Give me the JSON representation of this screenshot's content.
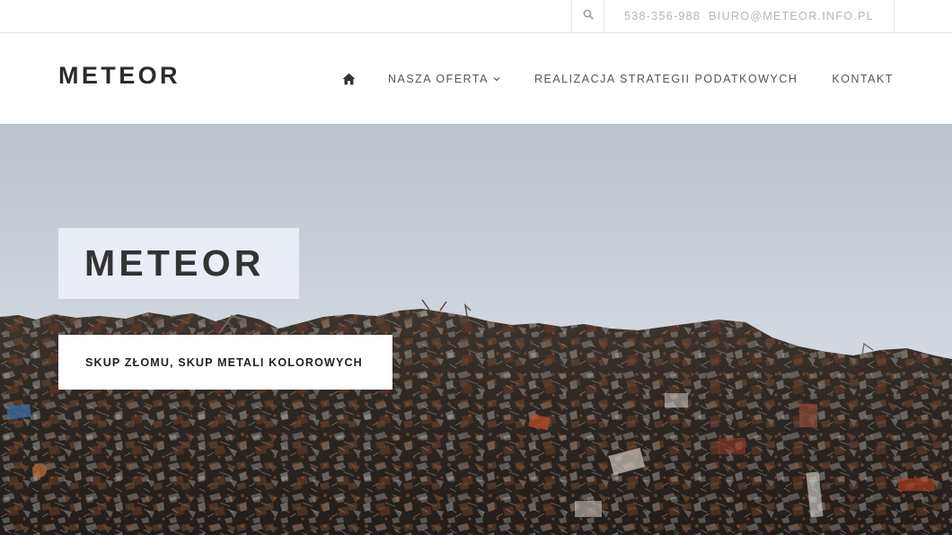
{
  "topbar": {
    "search_icon": "search-icon",
    "phone": "538-356-988",
    "email": "BIURO@METEOR.INFO.PL"
  },
  "header": {
    "logo": "METEOR",
    "nav": {
      "home_icon": "home-icon",
      "items": [
        {
          "label": "NASZA OFERTA",
          "has_dropdown": true
        },
        {
          "label": "REALIZACJA STRATEGII PODATKOWYCH",
          "has_dropdown": false
        },
        {
          "label": "KONTAKT",
          "has_dropdown": false
        }
      ]
    }
  },
  "hero": {
    "title": "METEOR",
    "subtitle": "SKUP ZŁOMU, SKUP METALI KOLOROWYCH"
  },
  "colors": {
    "sky": "#cfd4dc",
    "scrap_dark": "#2a2522",
    "title_box_bg": "#eceff6",
    "text_dark": "#333333",
    "muted": "#b5b5b5"
  }
}
